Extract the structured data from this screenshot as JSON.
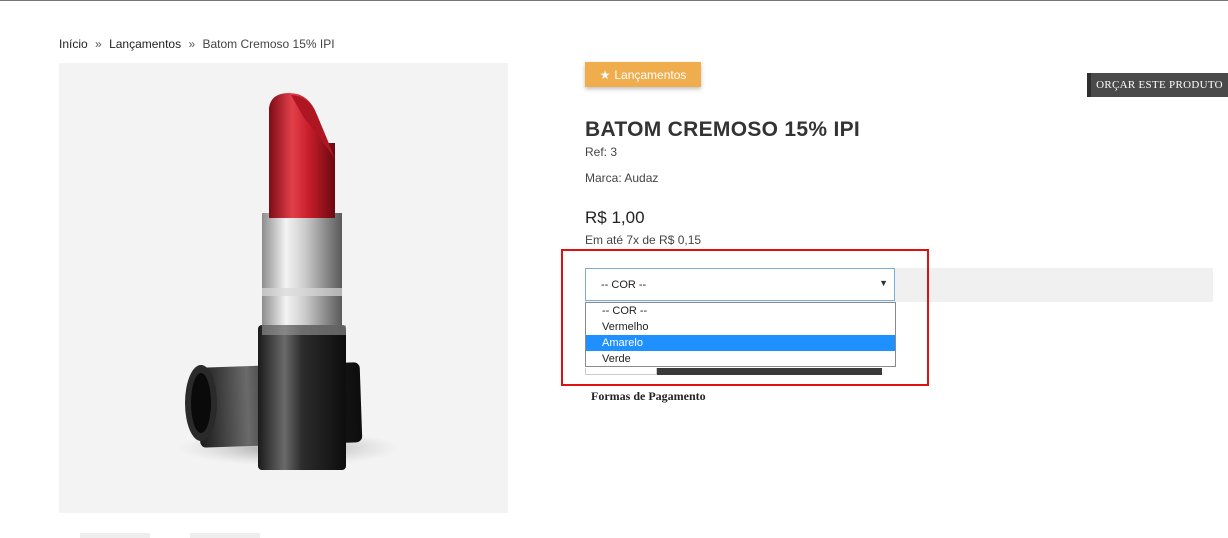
{
  "breadcrumb": {
    "home": "Início",
    "separator": "»",
    "category": "Lançamentos",
    "current": "Batom Cremoso 15% IPI"
  },
  "product": {
    "category_badge": "Lançamentos",
    "category_icon": "star-icon",
    "title": "BATOM CREMOSO 15% IPI",
    "ref": "Ref: 3",
    "brand": "Marca: Audaz",
    "price": "R$ 1,00",
    "installments": "Em até 7x de R$ 0,15",
    "image_alt": "lipstick"
  },
  "actions": {
    "quote_label": "ORÇAR ESTE PRODUTO"
  },
  "color_select": {
    "value": "-- COR --",
    "options": [
      "-- COR --",
      "Vermelho",
      "Amarelo",
      "Verde"
    ],
    "highlighted_option": "Amarelo"
  },
  "payment": {
    "heading": "Formas de Pagamento"
  },
  "colors": {
    "badge": "#f0ad4e",
    "highlight_option": "#1e90ff",
    "annotation_border": "#e01010",
    "lipstick_red": "#c81e2c"
  }
}
